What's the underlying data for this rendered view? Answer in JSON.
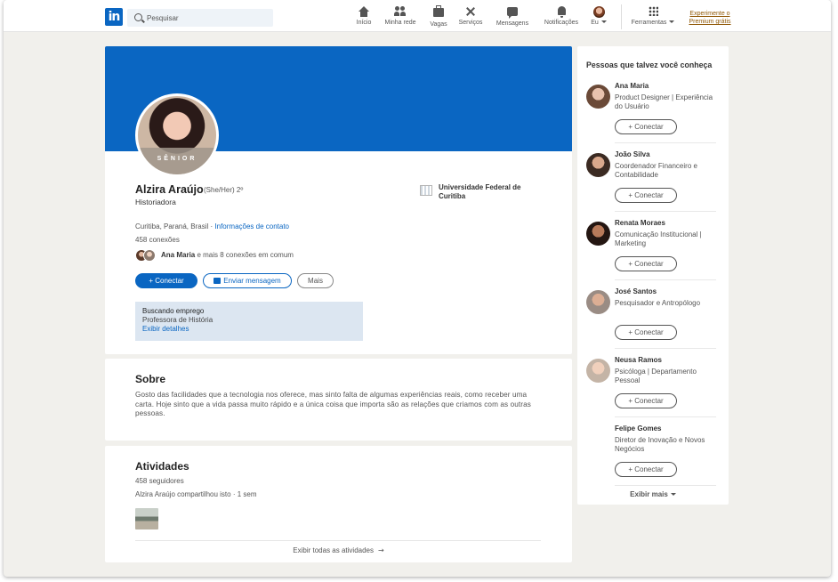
{
  "nav": {
    "logo": "in",
    "search_placeholder": "Pesquisar",
    "items": [
      {
        "label": "Início",
        "icon": "home-icon"
      },
      {
        "label": "Minha rede",
        "icon": "people-icon"
      },
      {
        "label": "Vagas",
        "icon": "briefcase-icon"
      },
      {
        "label": "Serviços",
        "icon": "tools-icon"
      },
      {
        "label": "Mensagens",
        "icon": "message-icon"
      },
      {
        "label": "Notificações",
        "icon": "bell-icon"
      },
      {
        "label": "Eu",
        "icon": "me-avatar"
      },
      {
        "label": "Ferramentas",
        "icon": "grid-icon"
      }
    ],
    "premium": "Experimente o Premium grátis"
  },
  "profile": {
    "badge": "SÊNIOR",
    "name": "Alzira Araújo",
    "pronouns": "(She/Her) 2º",
    "headline": "Historiadora",
    "university": "Universidade Federal de Curitiba",
    "location": "Curitiba, Paraná, Brasil ·",
    "contact_info": "Informações de contato",
    "connections": "458 conexões",
    "mutual_name": "Ana Maria",
    "mutual_rest": "e mais 8 conexões em comum",
    "connect_label": "Conectar",
    "message_label": "Enviar mensagem",
    "more_label": "Mais",
    "open_to_work": {
      "title": "Buscando emprego",
      "role": "Professora de História",
      "link": "Exibir detalhes"
    }
  },
  "about": {
    "title": "Sobre",
    "text": "Gosto das facilidades que a tecnologia nos oferece, mas sinto falta de algumas experiências reais, como receber uma carta. Hoje sinto que a vida passa muito rápido e a única coisa que importa são as relações que criamos com as outras pessoas."
  },
  "activity": {
    "title": "Atividades",
    "followers": "458 seguidores",
    "shared": "Alzira Araújo compartilhou isto · 1 sem",
    "show_all": "Exibir todas as atividades"
  },
  "sidebar": {
    "title": "Pessoas que talvez você conheça",
    "connect_label": "Conectar",
    "show_more": "Exibir mais",
    "people": [
      {
        "name": "Ana Maria",
        "desc": "Product Designer | Experiência do Usuário"
      },
      {
        "name": "João Silva",
        "desc": "Coordenador Financeiro e Contabilidade"
      },
      {
        "name": "Renata Moraes",
        "desc": "Comunicação Institucional | Marketing"
      },
      {
        "name": "José Santos",
        "desc": "Pesquisador e Antropólogo"
      },
      {
        "name": "Neusa Ramos",
        "desc": "Psicóloga | Departamento Pessoal"
      },
      {
        "name": "Felipe Gomes",
        "desc": "Diretor de Inovação e Novos Negócios"
      }
    ]
  },
  "colors": {
    "brand": "#0a66c2",
    "premium": "#915907",
    "background": "#f1f0ec"
  }
}
